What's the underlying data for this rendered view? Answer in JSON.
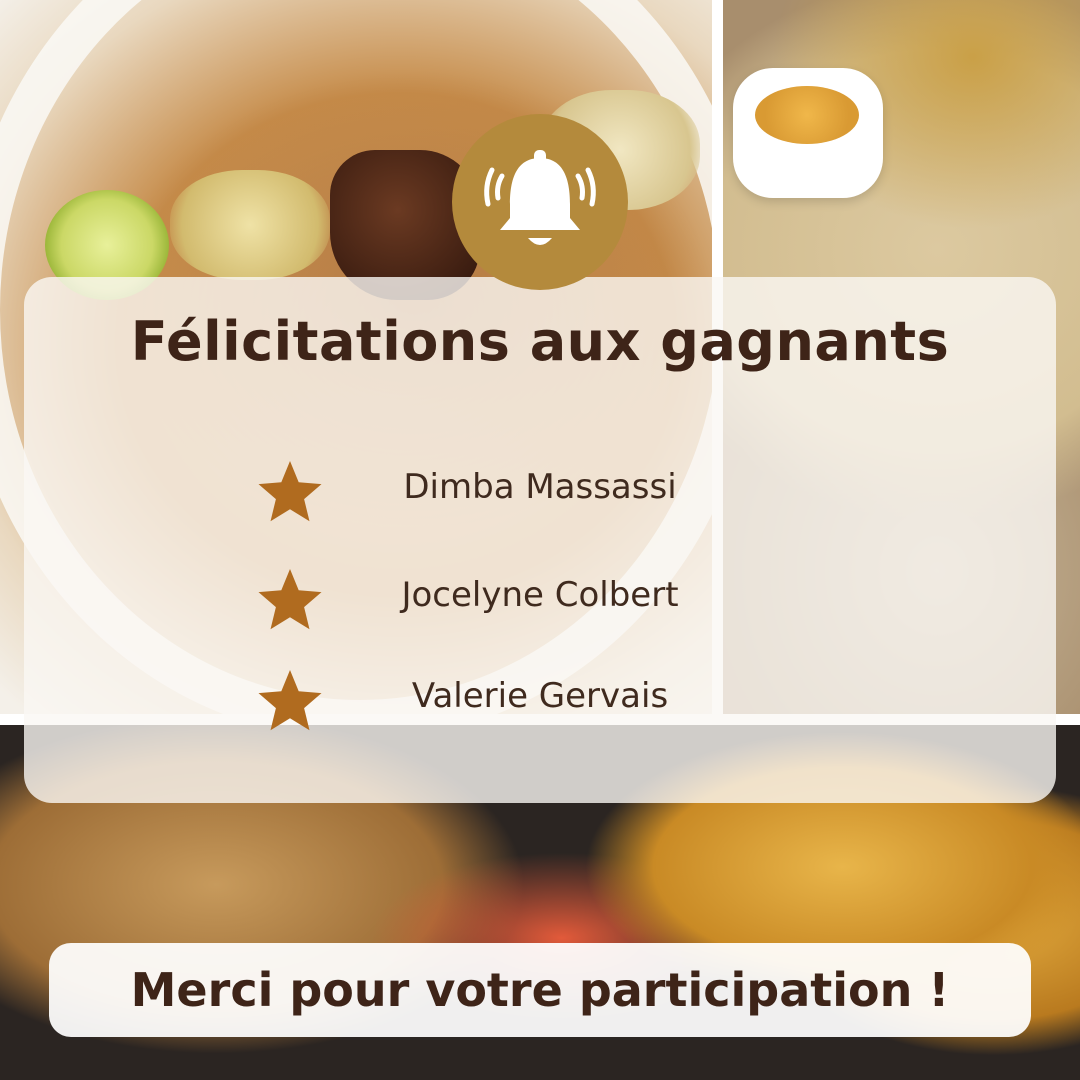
{
  "title": "Félicitations aux gagnants",
  "winners": [
    {
      "name": "Dimba Massassi"
    },
    {
      "name": "Jocelyne Colbert"
    },
    {
      "name": "Valerie Gervais"
    }
  ],
  "footer": {
    "text": "Merci pour votre participation !"
  },
  "icons": {
    "header": "bell-ringing-icon",
    "winner_marker": "star-icon"
  },
  "colors": {
    "accent_gold": "#b48a3c",
    "star_brown": "#b06b1f",
    "text_dark": "#3e2418",
    "panel": "#faf8f4"
  }
}
